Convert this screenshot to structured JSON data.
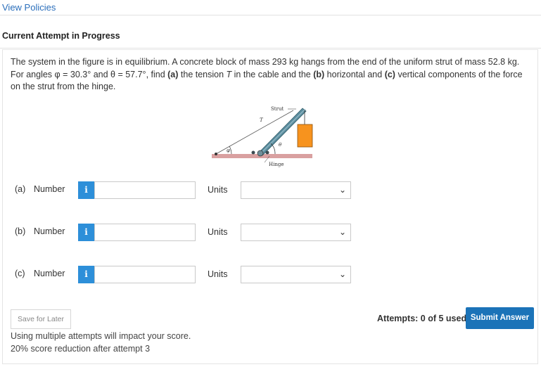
{
  "header": {
    "policies_link": "View Policies",
    "attempt_title": "Current Attempt in Progress"
  },
  "question": {
    "text_1": "The system in the figure is in equilibrium. A concrete block of mass 293 kg hangs from the end of the uniform strut of mass 52.8 kg. For angles ",
    "phi_eq": "φ = 30.3°",
    "text_2": " and ",
    "theta_eq": "θ = 57.7°",
    "text_3": ", find ",
    "part_a_tag": "(a)",
    "text_4": " the tension ",
    "tension_symbol": "T",
    "text_5": " in the cable and the ",
    "part_b_tag": "(b)",
    "text_6": " horizontal and ",
    "part_c_tag": "(c)",
    "text_7": " vertical components of the force on the strut from the hinge."
  },
  "figure": {
    "strut_label": "Strut",
    "tension_label": "T",
    "phi_label": "φ",
    "theta_label": "θ",
    "hinge_label": "Hinge",
    "colors": {
      "ground": "#d9a0a0",
      "strut": "#5d8fa0",
      "block": "#f7931e"
    }
  },
  "answers": [
    {
      "part": "(a)",
      "label": "Number",
      "info": "i",
      "value": "",
      "units_label": "Units",
      "units_value": ""
    },
    {
      "part": "(b)",
      "label": "Number",
      "info": "i",
      "value": "",
      "units_label": "Units",
      "units_value": ""
    },
    {
      "part": "(c)",
      "label": "Number",
      "info": "i",
      "value": "",
      "units_label": "Units",
      "units_value": ""
    }
  ],
  "footer": {
    "save_label": "Save for Later",
    "note_line1": "Using multiple attempts will impact your score.",
    "note_line2": "20% score reduction after attempt 3",
    "attempts_text": "Attempts: 0 of 5 used",
    "submit_label": "Submit Answer"
  },
  "colors": {
    "link": "#2a6ebb",
    "info_button": "#2d8fd9",
    "submit_button": "#1b73b8"
  }
}
